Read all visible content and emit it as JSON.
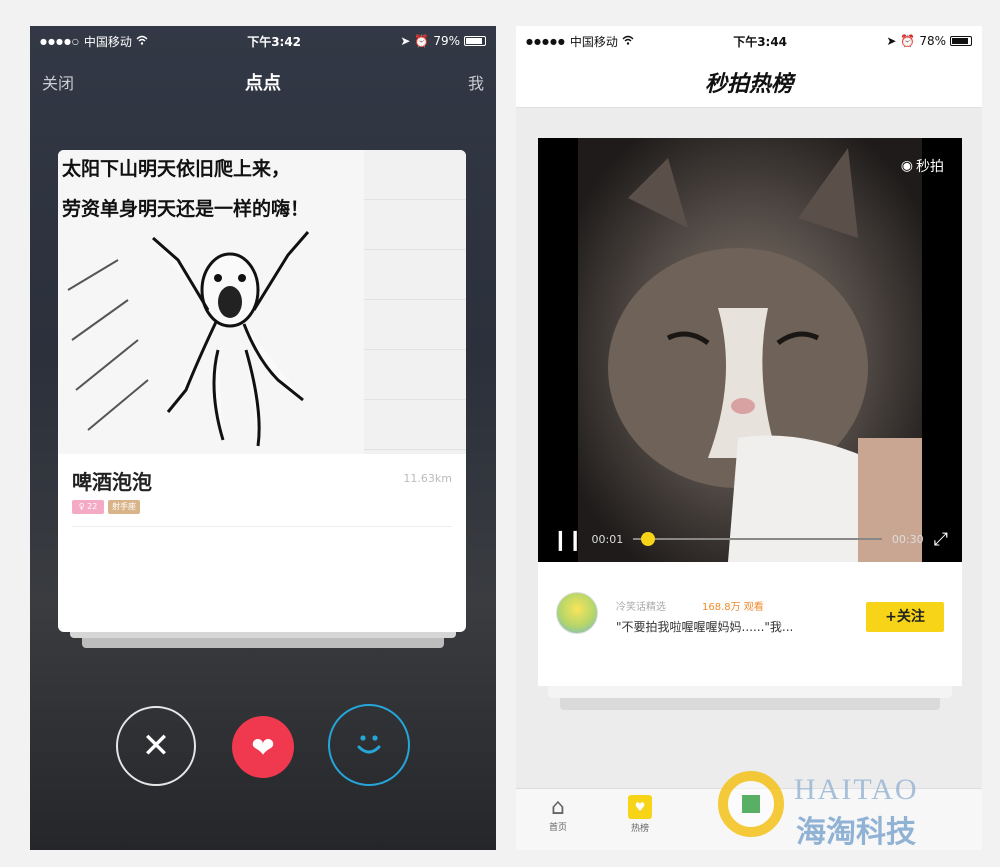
{
  "left_phone": {
    "status": {
      "signal": "●●●●○",
      "carrier": "中国移动",
      "time": "下午3:42",
      "battery": "79%",
      "battery_level": 0.79
    },
    "nav": {
      "left": "关闭",
      "title": "点点",
      "right": "我"
    },
    "card": {
      "meme_line1": "太阳下山明天依旧爬上来，",
      "meme_line2": "劳资单身明天还是一样的嗨！",
      "name": "啤酒泡泡",
      "distance": "11.63km",
      "tags": [
        {
          "label": "♀ 22",
          "color": "#f4a9c4"
        },
        {
          "label": "射手座",
          "color": "#d9b48a"
        }
      ]
    },
    "actions": {
      "dislike": "✕",
      "like": "❤",
      "smile": "☺"
    },
    "colors": {
      "like": "#f0384f",
      "smile_ring": "#25a6d9"
    }
  },
  "right_phone": {
    "status": {
      "signal": "●●●●●",
      "carrier": "中国移动",
      "time": "下午3:44",
      "battery": "78%",
      "battery_level": 0.78
    },
    "nav_title": "秒拍热榜",
    "video": {
      "watermark": "秒拍",
      "elapsed": "00:01",
      "total": "00:30",
      "progress": 0.03
    },
    "author": {
      "name": "冷笑话精选",
      "views": "168.8万 观看",
      "caption": "\"不要拍我啦喔喔喔妈妈......\"我...",
      "follow": "+关注"
    },
    "tabs": [
      {
        "label": "首页",
        "icon": "home-icon"
      },
      {
        "label": "热榜",
        "icon": "hot-icon"
      }
    ],
    "watermark": {
      "brand_en": "HAITAO",
      "brand_cn": "海淘科技"
    },
    "colors": {
      "accent": "#f7d417",
      "views": "#f08a2c"
    }
  }
}
